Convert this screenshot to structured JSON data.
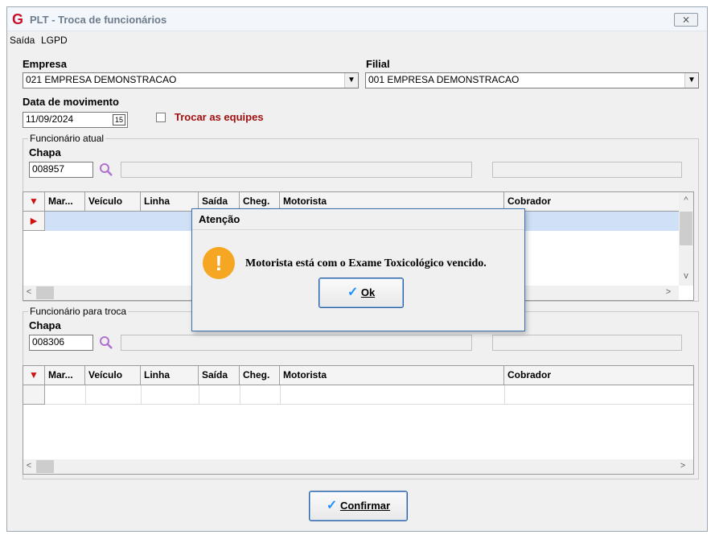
{
  "window": {
    "title": "PLT - Troca de funcionários",
    "close_label": "⨯"
  },
  "menu": [
    "Saída",
    "LGPD"
  ],
  "empresa": {
    "label": "Empresa",
    "value": "021 EMPRESA DEMONSTRACAO"
  },
  "filial": {
    "label": "Filial",
    "value": "001 EMPRESA DEMONSTRACAO"
  },
  "data_movimento": {
    "label": "Data de movimento",
    "value": "11/09/2024",
    "calendar_label": "15"
  },
  "trocar_equipes": {
    "label": "Trocar as equipes",
    "checked": false
  },
  "funcionario_atual": {
    "group_label": "Funcionário atual",
    "chapa_label": "Chapa",
    "chapa_value": "008957",
    "name_value": "",
    "extra_value": ""
  },
  "funcionario_troca": {
    "group_label": "Funcionário para troca",
    "chapa_label": "Chapa",
    "chapa_value": "008306",
    "name_value": "",
    "extra_value": ""
  },
  "grid_columns": [
    "Mar...",
    "Veículo",
    "Linha",
    "Saída",
    "Cheg.",
    "Motorista",
    "Cobrador"
  ],
  "grid_columns_top": [
    "Mar...",
    "Veículo",
    "Linha",
    "Saída",
    "Cheg.",
    "Motorista",
    "Cobrador"
  ],
  "dialog": {
    "title": "Atenção",
    "message": "Motorista está com o Exame Toxicológico vencido.",
    "ok_label": "Ok"
  },
  "confirm_label": "Confirmar",
  "colors": {
    "accent": "#c8102e",
    "selection": "#cfe0f7",
    "warning": "#f5a623",
    "check": "#1e90ff"
  }
}
